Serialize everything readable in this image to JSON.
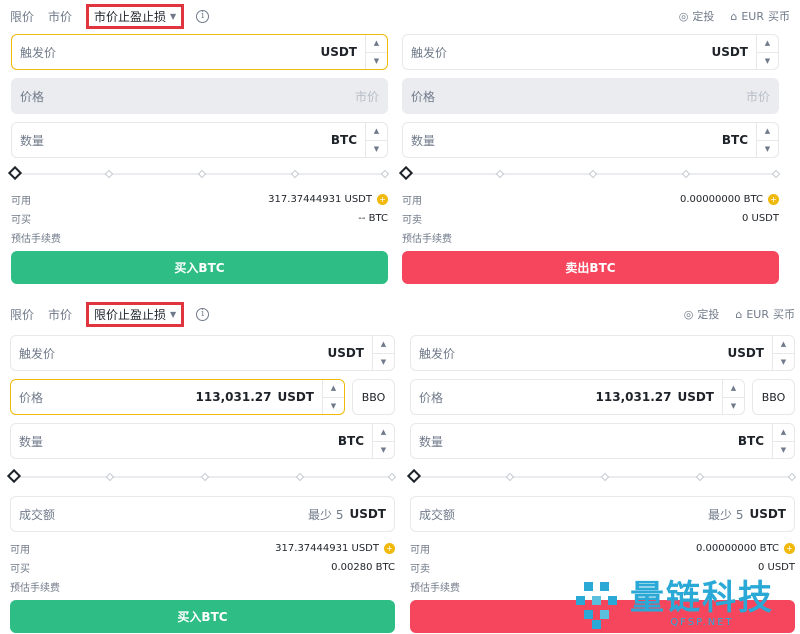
{
  "top": {
    "tabs": [
      "限价",
      "市价"
    ],
    "selected_order_type": "市价止盈止损",
    "links": {
      "dca": "定投",
      "buy_currency": "EUR",
      "buy_label": "买币"
    },
    "buy": {
      "trigger": {
        "label": "触发价",
        "unit": "USDT"
      },
      "price": {
        "label": "价格",
        "placeholder": "市价"
      },
      "amount": {
        "label": "数量",
        "unit": "BTC"
      },
      "available_label": "可用",
      "available_value": "317.37444931 USDT",
      "can_label": "可买",
      "can_value": "-- BTC",
      "fee_label": "预估手续费",
      "button": "买入BTC"
    },
    "sell": {
      "trigger": {
        "label": "触发价",
        "unit": "USDT"
      },
      "price": {
        "label": "价格",
        "placeholder": "市价"
      },
      "amount": {
        "label": "数量",
        "unit": "BTC"
      },
      "available_label": "可用",
      "available_value": "0.00000000 BTC",
      "can_label": "可卖",
      "can_value": "0 USDT",
      "fee_label": "预估手续费",
      "button": "卖出BTC"
    }
  },
  "bottom": {
    "tabs": [
      "限价",
      "市价"
    ],
    "selected_order_type": "限价止盈止损",
    "links": {
      "dca": "定投",
      "buy_currency": "EUR",
      "buy_label": "买币"
    },
    "buy": {
      "trigger": {
        "label": "触发价",
        "unit": "USDT"
      },
      "price": {
        "label": "价格",
        "value": "113,031.27",
        "unit": "USDT"
      },
      "bbo": "BBO",
      "amount": {
        "label": "数量",
        "unit": "BTC"
      },
      "total": {
        "label": "成交额",
        "placeholder": "最少 5",
        "unit": "USDT"
      },
      "available_label": "可用",
      "available_value": "317.37444931 USDT",
      "can_label": "可买",
      "can_value": "0.00280 BTC",
      "fee_label": "预估手续费",
      "button": "买入BTC"
    },
    "sell": {
      "trigger": {
        "label": "触发价",
        "unit": "USDT"
      },
      "price": {
        "label": "价格",
        "value": "113,031.27",
        "unit": "USDT"
      },
      "bbo": "BBO",
      "amount": {
        "label": "数量",
        "unit": "BTC"
      },
      "total": {
        "label": "成交额",
        "placeholder": "最少 5",
        "unit": "USDT"
      },
      "available_label": "可用",
      "available_value": "0.00000000 BTC",
      "can_label": "可卖",
      "can_value": "0 USDT",
      "fee_label": "预估手续费"
    }
  },
  "watermark": {
    "title": "量链科技",
    "subtitle": "QFSP.NET"
  },
  "colors": {
    "buy": "#2ebd85",
    "sell": "#f6465d",
    "highlight": "#e0343e",
    "focus": "#f0b90b",
    "watermark": "#2aa9d6"
  },
  "icons": {
    "info": "info-icon",
    "dca": "dca-icon",
    "buy_crypto": "buy-crypto-icon",
    "coin": "add-funds-icon",
    "stepper": "stepper-arrows"
  }
}
